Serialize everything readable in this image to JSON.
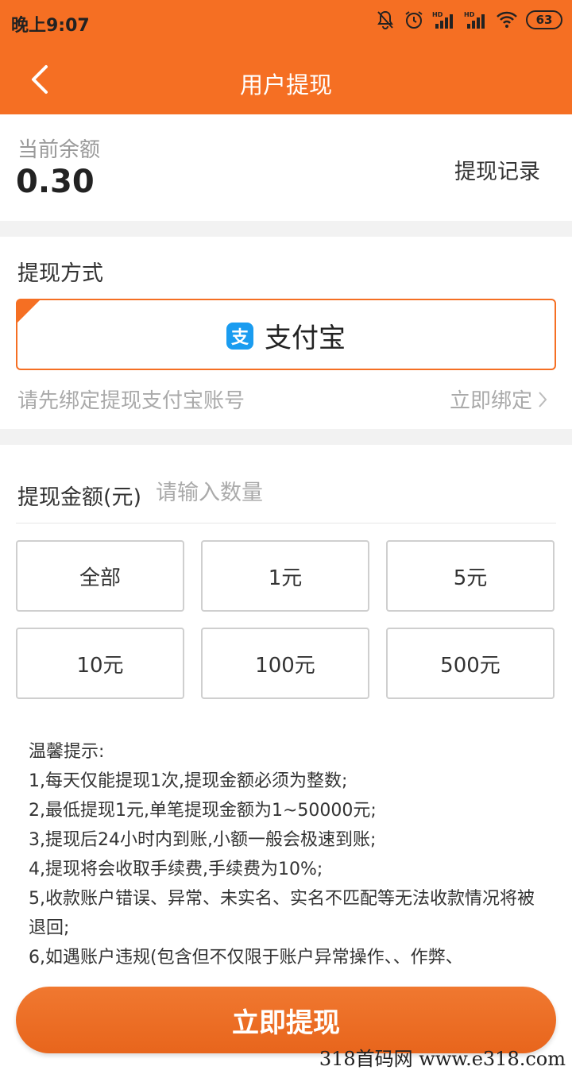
{
  "status_bar": {
    "time": "晚上9:07",
    "battery": "63",
    "signal1": "HD",
    "signal2": "HD"
  },
  "nav": {
    "title": "用户提现"
  },
  "balance": {
    "label": "当前余额",
    "value": "0.30",
    "history_link": "提现记录"
  },
  "method": {
    "label": "提现方式",
    "option_label": "支付宝",
    "option_icon_glyph": "支",
    "bind_hint": "请先绑定提现支付宝账号",
    "bind_link": "立即绑定"
  },
  "amount": {
    "label": "提现金额(元)",
    "placeholder": "请输入数量",
    "options": [
      "全部",
      "1元",
      "5元",
      "10元",
      "100元",
      "500元"
    ]
  },
  "tips": {
    "title": "温馨提示:",
    "lines": [
      "1,每天仅能提现1次,提现金额必须为整数;",
      "2,最低提现1元,单笔提现金额为1~50000元;",
      "3,提现后24小时内到账,小额一般会极速到账;",
      "4,提现将会收取手续费,手续费为10%;",
      "5,收款账户错误、异常、未实名、实名不匹配等无法收款情况将被退回;",
      "6,如遇账户违规(包含但不仅限于账户异常操作、、作弊、"
    ]
  },
  "submit": {
    "label": "立即提现"
  },
  "watermark": "318首码网 www.e318.com",
  "colors": {
    "accent": "#f56f23",
    "alipay_blue": "#1a9cf0"
  }
}
